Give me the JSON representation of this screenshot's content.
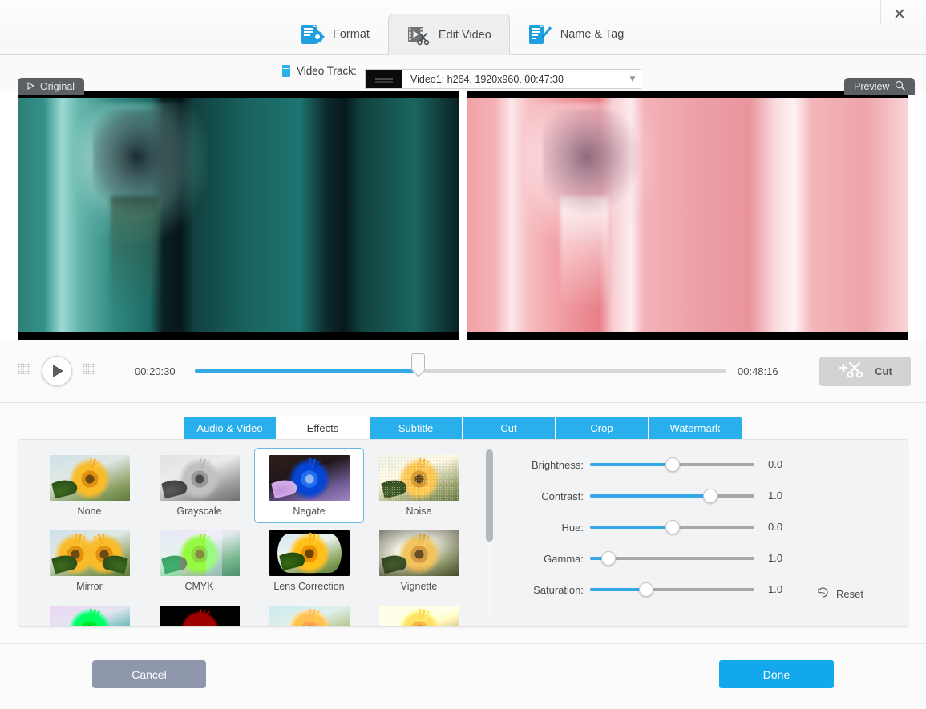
{
  "window": {
    "close_label": "✕"
  },
  "main_tabs": [
    {
      "label": "Format",
      "icon": "format-document-gear-icon",
      "active": false
    },
    {
      "label": "Edit Video",
      "icon": "film-scissors-icon",
      "active": true
    },
    {
      "label": "Name & Tag",
      "icon": "document-pencil-icon",
      "active": false
    }
  ],
  "track": {
    "label": "Video Track:",
    "icon": "video-track-icon",
    "selected": "Video1: h264, 1920x960, 00:47:30",
    "caret_icon": "chevron-down-icon"
  },
  "preview": {
    "original_label": "Original",
    "original_icon": "play-triangle-icon",
    "preview_label": "Preview",
    "preview_icon": "magnifier-icon"
  },
  "transport": {
    "play_icon": "play-icon",
    "grip_icon": "drag-grip-icon",
    "start_time": "00:20:30",
    "end_time": "00:48:16",
    "progress_percent": 42,
    "cut_label": "Cut",
    "cut_icon": "add-scissors-icon"
  },
  "sub_tabs": [
    {
      "label": "Audio & Video",
      "active": false
    },
    {
      "label": "Effects",
      "active": true
    },
    {
      "label": "Subtitle",
      "active": false
    },
    {
      "label": "Cut",
      "active": false
    },
    {
      "label": "Crop",
      "active": false
    },
    {
      "label": "Watermark",
      "active": false
    }
  ],
  "effects": [
    {
      "label": "None",
      "style": "t-none",
      "selected": false
    },
    {
      "label": "Grayscale",
      "style": "t-gray",
      "selected": false
    },
    {
      "label": "Negate",
      "style": "t-negate",
      "selected": true
    },
    {
      "label": "Noise",
      "style": "t-noise",
      "selected": false
    },
    {
      "label": "Mirror",
      "style": "t-mirror",
      "selected": false
    },
    {
      "label": "CMYK",
      "style": "t-cmyk",
      "selected": false
    },
    {
      "label": "Lens Correction",
      "style": "t-lens",
      "selected": false
    },
    {
      "label": "Vignette",
      "style": "t-vig",
      "selected": false
    },
    {
      "label": "",
      "style": "t-green",
      "selected": false
    },
    {
      "label": "",
      "style": "t-edge",
      "selected": false
    },
    {
      "label": "",
      "style": "t-cross",
      "selected": false
    },
    {
      "label": "",
      "style": "t-warm",
      "selected": false
    }
  ],
  "sliders": [
    {
      "label": "Brightness:",
      "value": "0.0",
      "fill_percent": 50
    },
    {
      "label": "Contrast:",
      "value": "1.0",
      "fill_percent": 73
    },
    {
      "label": "Hue:",
      "value": "0.0",
      "fill_percent": 50
    },
    {
      "label": "Gamma:",
      "value": "1.0",
      "fill_percent": 11
    },
    {
      "label": "Saturation:",
      "value": "1.0",
      "fill_percent": 34
    }
  ],
  "reset": {
    "label": "Reset",
    "icon": "undo-clock-icon"
  },
  "footer": {
    "cancel_label": "Cancel",
    "done_label": "Done"
  },
  "colors": {
    "accent": "#29b0ec",
    "slider_blue": "#35a9e8",
    "done_blue": "#13a8ec",
    "cancel_gray": "#8e97ac",
    "panel_bg": "#f1f3f4"
  }
}
